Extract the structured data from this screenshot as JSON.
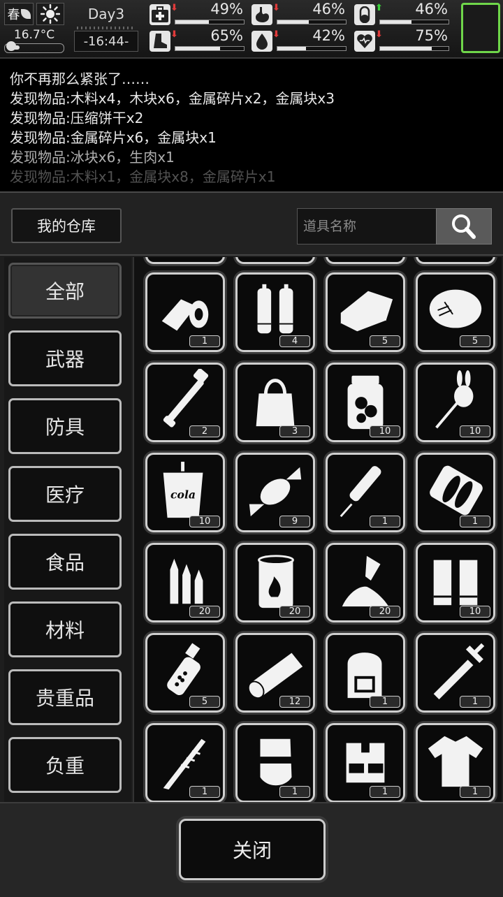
{
  "status": {
    "season": "春",
    "temperature": "16.7°C",
    "temperature_level": 0.15,
    "day": "Day3",
    "time": "-16:44-",
    "stats": [
      {
        "name": "health",
        "icon": "medkit-icon",
        "value": "49%",
        "level": 0.49,
        "trend": "down",
        "trend_color": "#e03a3a"
      },
      {
        "name": "hunger",
        "icon": "stomach-icon",
        "value": "46%",
        "level": 0.46,
        "trend": "down",
        "trend_color": "#e03a3a"
      },
      {
        "name": "mood",
        "icon": "pill-icon",
        "value": "46%",
        "level": 0.46,
        "trend": "up",
        "trend_color": "#3ad03a"
      },
      {
        "name": "stamina",
        "icon": "boot-icon",
        "value": "65%",
        "level": 0.65,
        "trend": "down",
        "trend_color": "#e03a3a"
      },
      {
        "name": "thirst",
        "icon": "water-drop-icon",
        "value": "42%",
        "level": 0.42,
        "trend": "down",
        "trend_color": "#e03a3a"
      },
      {
        "name": "spirit",
        "icon": "heart-icon",
        "value": "75%",
        "level": 0.75,
        "trend": "down",
        "trend_color": "#e03a3a"
      }
    ],
    "equip_slot_color": "#6fd64a"
  },
  "log": [
    {
      "text": "你不再那么紧张了……",
      "opacity": 1.0
    },
    {
      "text": "发现物品:木料x4，木块x6，金属碎片x2，金属块x3",
      "opacity": 1.0
    },
    {
      "text": "发现物品:压缩饼干x2",
      "opacity": 1.0
    },
    {
      "text": "发现物品:金属碎片x6，金属块x1",
      "opacity": 1.0
    },
    {
      "text": "发现物品:冰块x6，生肉x1",
      "opacity": 0.75
    },
    {
      "text": "发现物品:木料x1，金属块x8，金属碎片x1",
      "opacity": 0.35
    }
  ],
  "panel": {
    "title": "我的仓库",
    "search_placeholder": "道具名称",
    "close_label": "关闭"
  },
  "categories": [
    {
      "label": "全部",
      "active": true
    },
    {
      "label": "武器",
      "active": false
    },
    {
      "label": "防具",
      "active": false
    },
    {
      "label": "医疗",
      "active": false
    },
    {
      "label": "食品",
      "active": false
    },
    {
      "label": "材料",
      "active": false
    },
    {
      "label": "贵重品",
      "active": false
    },
    {
      "label": "负重",
      "active": false
    }
  ],
  "items": [
    {
      "icon": "bandage-roll-icon",
      "qty": "1"
    },
    {
      "icon": "battery-pair-icon",
      "qty": "4"
    },
    {
      "icon": "cloth-towel-icon",
      "qty": "5"
    },
    {
      "icon": "cotton-tuft-icon",
      "qty": "5"
    },
    {
      "icon": "tire-pump-icon",
      "qty": "2"
    },
    {
      "icon": "tote-bag-icon",
      "qty": "3"
    },
    {
      "icon": "pickle-jar-icon",
      "qty": "10"
    },
    {
      "icon": "rabbit-lollipop-icon",
      "qty": "10"
    },
    {
      "icon": "cola-cup-icon",
      "qty": "10"
    },
    {
      "icon": "wrapped-candy-icon",
      "qty": "9"
    },
    {
      "icon": "syringe-pen-icon",
      "qty": "1"
    },
    {
      "icon": "canned-fish-icon",
      "qty": "1"
    },
    {
      "icon": "bullets-icon",
      "qty": "20"
    },
    {
      "icon": "fuel-barrel-icon",
      "qty": "20"
    },
    {
      "icon": "powder-pile-icon",
      "qty": "20"
    },
    {
      "icon": "shotgun-shells-icon",
      "qty": "10"
    },
    {
      "icon": "grenade-icon",
      "qty": "5"
    },
    {
      "icon": "wood-log-icon",
      "qty": "12"
    },
    {
      "icon": "backpack-icon",
      "qty": "1"
    },
    {
      "icon": "sword-icon",
      "qty": "1"
    },
    {
      "icon": "spiked-club-icon",
      "qty": "1"
    },
    {
      "icon": "riot-shield-icon",
      "qty": "1"
    },
    {
      "icon": "tactical-vest-icon",
      "qty": "1"
    },
    {
      "icon": "shirt-icon",
      "qty": "1"
    }
  ]
}
